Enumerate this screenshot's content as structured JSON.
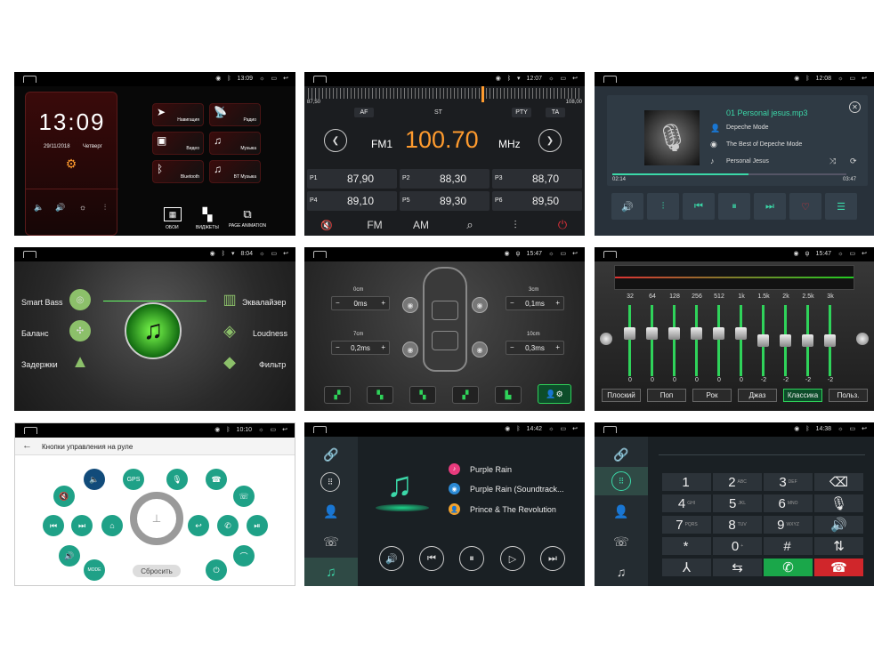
{
  "p1": {
    "time": "13:09",
    "clock": "13:09",
    "date": "29/11/2018",
    "day": "Четверг",
    "tiles": [
      "Навигация",
      "Радио",
      "Видео",
      "Музыка",
      "Bluetooth",
      "BT Музыка"
    ],
    "actions": [
      "ОБОИ",
      "ВИДЖЕТЫ",
      "PAGE ANIMATION"
    ]
  },
  "p2": {
    "time": "12:07",
    "scale_left": "87,50",
    "scale_right": "108,00",
    "af": "AF",
    "st": "ST",
    "pty": "PTY",
    "ta": "TA",
    "band": "FM1",
    "freq": "100.70",
    "unit": "MHz",
    "presets": [
      {
        "id": "P1",
        "f": "87,90"
      },
      {
        "id": "P2",
        "f": "88,30"
      },
      {
        "id": "P3",
        "f": "88,70"
      },
      {
        "id": "P4",
        "f": "89,10"
      },
      {
        "id": "P5",
        "f": "89,30"
      },
      {
        "id": "P6",
        "f": "89,50"
      }
    ],
    "fm": "FM",
    "am": "AM"
  },
  "p3": {
    "time": "12:08",
    "track": "01 Personal jesus.mp3",
    "artist": "Depeche Mode",
    "album": "The Best of Depeche Mode",
    "song": "Personal Jesus",
    "elapsed": "02:14",
    "total": "03:47",
    "progress": 0.58
  },
  "p4": {
    "time": "8:04",
    "left": [
      "Smart Bass",
      "Баланс",
      "Задержки"
    ],
    "right": [
      "Эквалайзер",
      "Loudness",
      "Фильтр"
    ]
  },
  "p5": {
    "time": "15:47",
    "labels": [
      "0cm",
      "3cm",
      "7cm",
      "10cm"
    ],
    "values": [
      "0ms",
      "0,1ms",
      "0,2ms",
      "0,3ms"
    ],
    "minus": "−",
    "plus": "+"
  },
  "p6": {
    "time": "15:47",
    "freqs": [
      "32",
      "64",
      "128",
      "256",
      "512",
      "1k",
      "1.5k",
      "2k",
      "2.5k",
      "3k"
    ],
    "vals": [
      "0",
      "0",
      "0",
      "0",
      "0",
      "0",
      "-2",
      "-2",
      "-2",
      "-2"
    ],
    "presets": [
      "Плоский",
      "Поп",
      "Рок",
      "Джаз",
      "Классика",
      "Польз."
    ]
  },
  "p7": {
    "time": "10:10",
    "title": "Кнопки управления на руле",
    "gps": "GPS",
    "mode": "MODE",
    "reset": "Сбросить"
  },
  "p8": {
    "time": "14:42",
    "items": [
      "Purple Rain",
      "Purple Rain (Soundtrack...",
      "Prince & The Revolution"
    ]
  },
  "p9": {
    "time": "14:38",
    "keys": [
      {
        "d": "1",
        "s": ""
      },
      {
        "d": "2",
        "s": "ABC"
      },
      {
        "d": "3",
        "s": "DEF"
      },
      {
        "d": "4",
        "s": "GHI"
      },
      {
        "d": "5",
        "s": "JKL"
      },
      {
        "d": "6",
        "s": "MNO"
      },
      {
        "d": "7",
        "s": "PQRS"
      },
      {
        "d": "8",
        "s": "TUV"
      },
      {
        "d": "9",
        "s": "WXYZ"
      },
      {
        "d": "*",
        "s": ""
      },
      {
        "d": "0",
        "s": "+"
      },
      {
        "d": "#",
        "s": ""
      }
    ]
  },
  "colors": {
    "accent_green": "#1fa187",
    "radio_orange": "#ff9b2e",
    "eq_green": "#2fd35a",
    "call_green": "#1aa74a",
    "call_red": "#d0262b"
  }
}
